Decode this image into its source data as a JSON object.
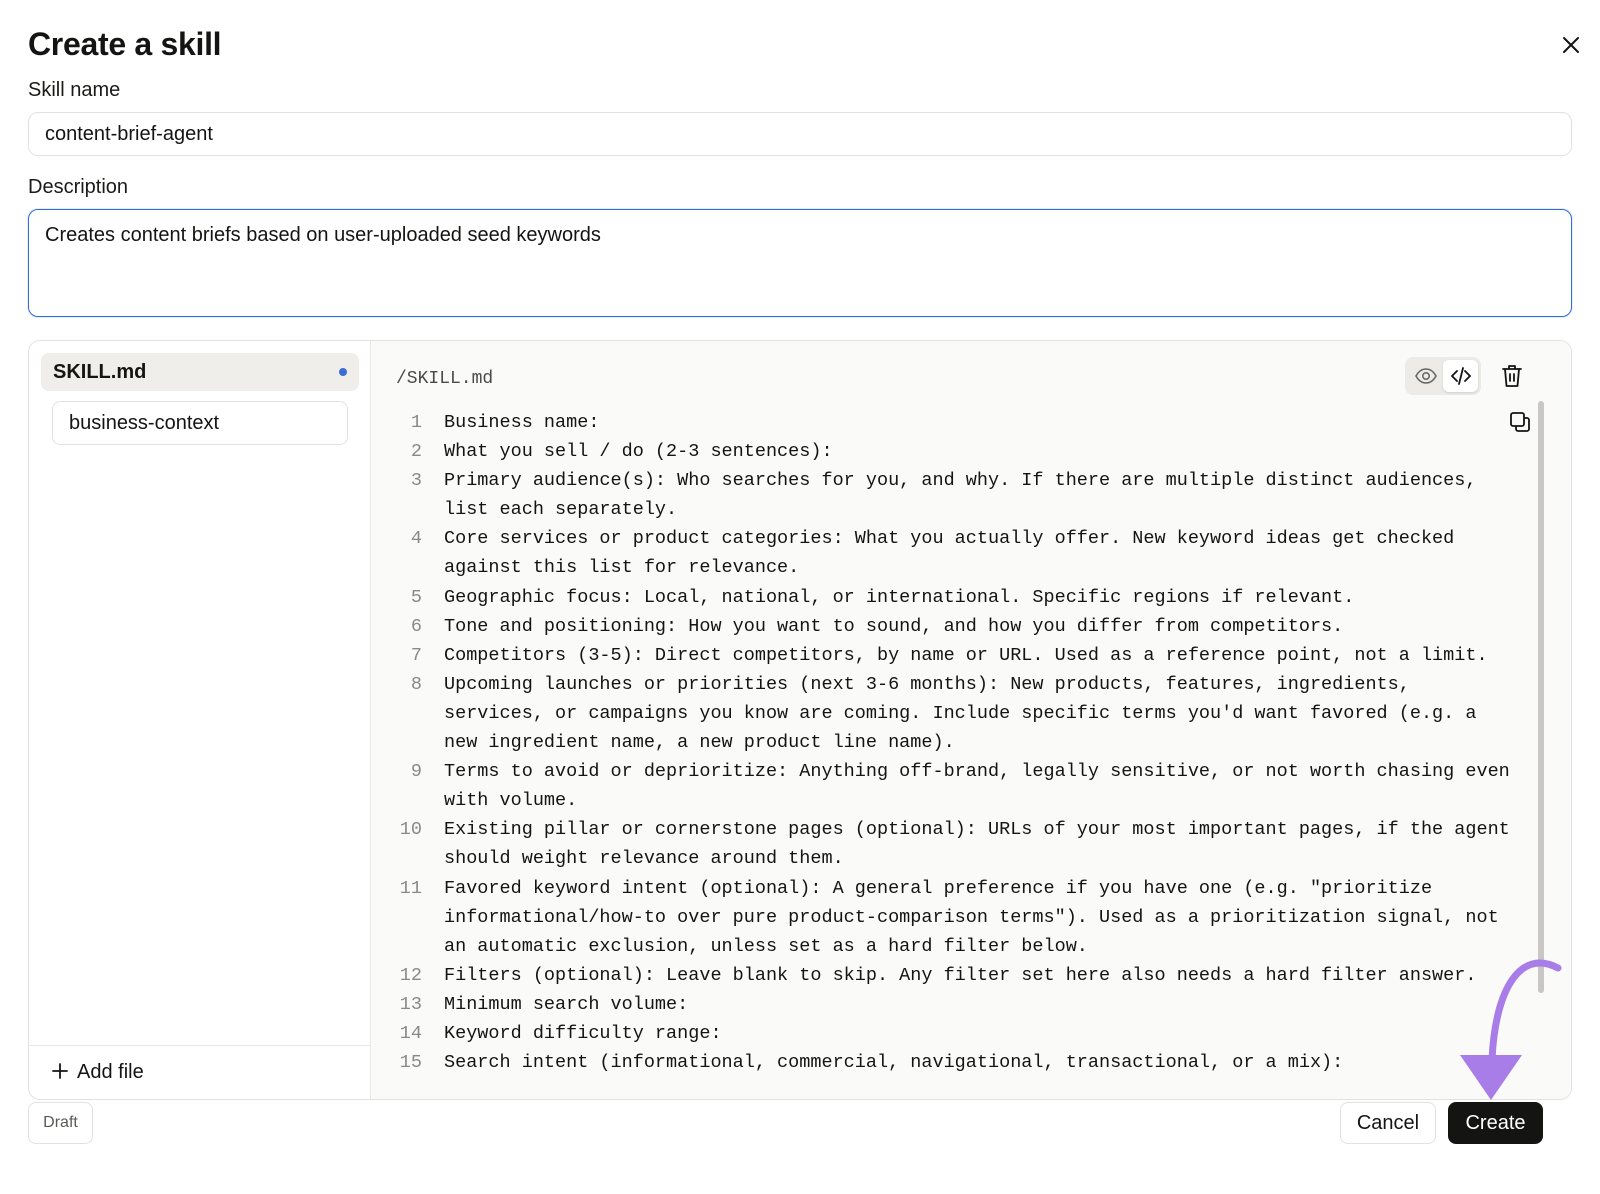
{
  "dialog": {
    "title": "Create a skill",
    "close_icon": "close-icon"
  },
  "skill_name": {
    "label": "Skill name",
    "value": "content-brief-agent"
  },
  "description": {
    "label": "Description",
    "value": "Creates content briefs based on user-uploaded seed keywords"
  },
  "files": {
    "items": [
      {
        "label": "SKILL.md",
        "active": true,
        "modified": true
      },
      {
        "label": "business-context",
        "active": false,
        "modified": false
      }
    ],
    "add_file_label": "Add file"
  },
  "editor": {
    "path": "/SKILL.md",
    "view_mode": "code",
    "lines": [
      {
        "no": "1",
        "text": "Business name:"
      },
      {
        "no": "2",
        "text": "What you sell / do (2-3 sentences):"
      },
      {
        "no": "3",
        "text": "Primary audience(s): Who searches for you, and why. If there are multiple distinct audiences, list each separately."
      },
      {
        "no": "4",
        "text": "Core services or product categories: What you actually offer. New keyword ideas get checked against this list for relevance."
      },
      {
        "no": "5",
        "text": "Geographic focus: Local, national, or international. Specific regions if relevant."
      },
      {
        "no": "6",
        "text": "Tone and positioning: How you want to sound, and how you differ from competitors."
      },
      {
        "no": "7",
        "text": "Competitors (3-5): Direct competitors, by name or URL. Used as a reference point, not a limit."
      },
      {
        "no": "8",
        "text": "Upcoming launches or priorities (next 3-6 months): New products, features, ingredients, services, or campaigns you know are coming. Include specific terms you'd want favored (e.g. a new ingredient name, a new product line name)."
      },
      {
        "no": "9",
        "text": "Terms to avoid or deprioritize: Anything off-brand, legally sensitive, or not worth chasing even with volume."
      },
      {
        "no": "10",
        "text": "Existing pillar or cornerstone pages (optional): URLs of your most important pages, if the agent should weight relevance around them."
      },
      {
        "no": "11",
        "text": "Favored keyword intent (optional): A general preference if you have one (e.g. \"prioritize informational/how-to over pure product-comparison terms\"). Used as a prioritization signal, not an automatic exclusion, unless set as a hard filter below."
      },
      {
        "no": "12",
        "text": "Filters (optional): Leave blank to skip. Any filter set here also needs a hard filter answer."
      },
      {
        "no": "13",
        "text": "Minimum search volume:"
      },
      {
        "no": "14",
        "text": "Keyword difficulty range:"
      },
      {
        "no": "15",
        "text": "Search intent (informational, commercial, navigational, transactional, or a mix):"
      }
    ]
  },
  "footer": {
    "status": "Draft",
    "cancel_label": "Cancel",
    "create_label": "Create"
  },
  "colors": {
    "accent_focus": "#2f6fd6",
    "annotation_arrow": "#a97de8",
    "primary_button": "#141413"
  }
}
